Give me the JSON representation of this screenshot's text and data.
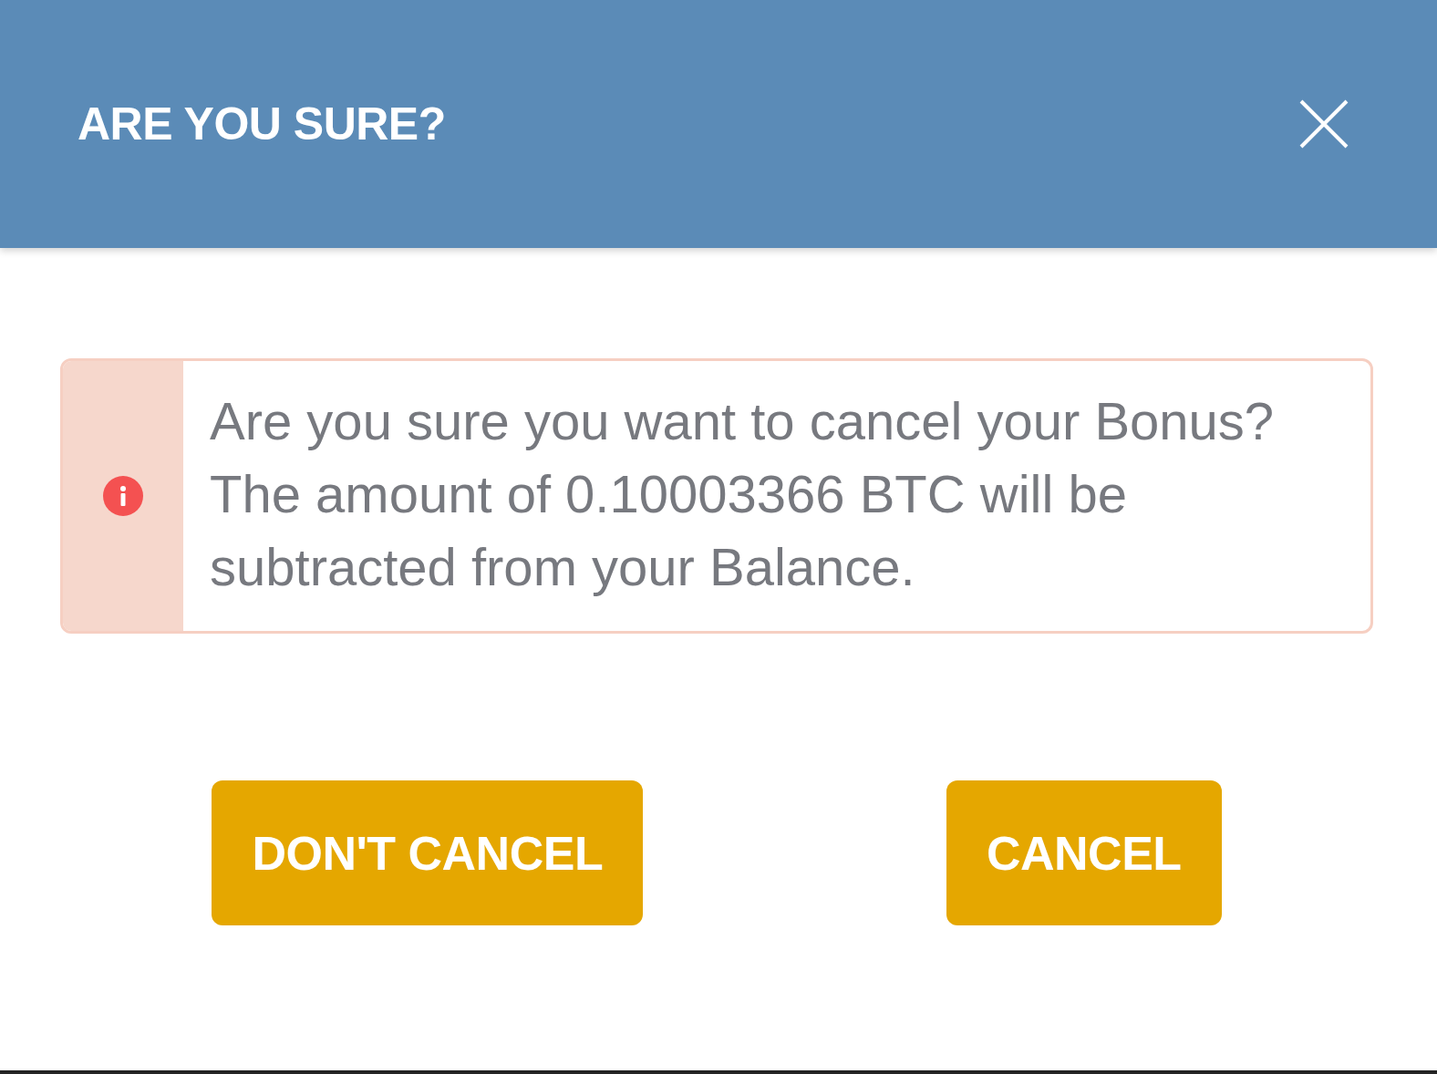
{
  "dialog": {
    "title": "ARE YOU SURE?"
  },
  "alert": {
    "kind": "error",
    "message": "Are you sure you want to cancel your Bonus? The amount of 0.10003366 BTC will be subtracted from your Balance."
  },
  "buttons": [
    {
      "label": "DON'T CANCEL"
    },
    {
      "label": "CANCEL"
    }
  ]
}
